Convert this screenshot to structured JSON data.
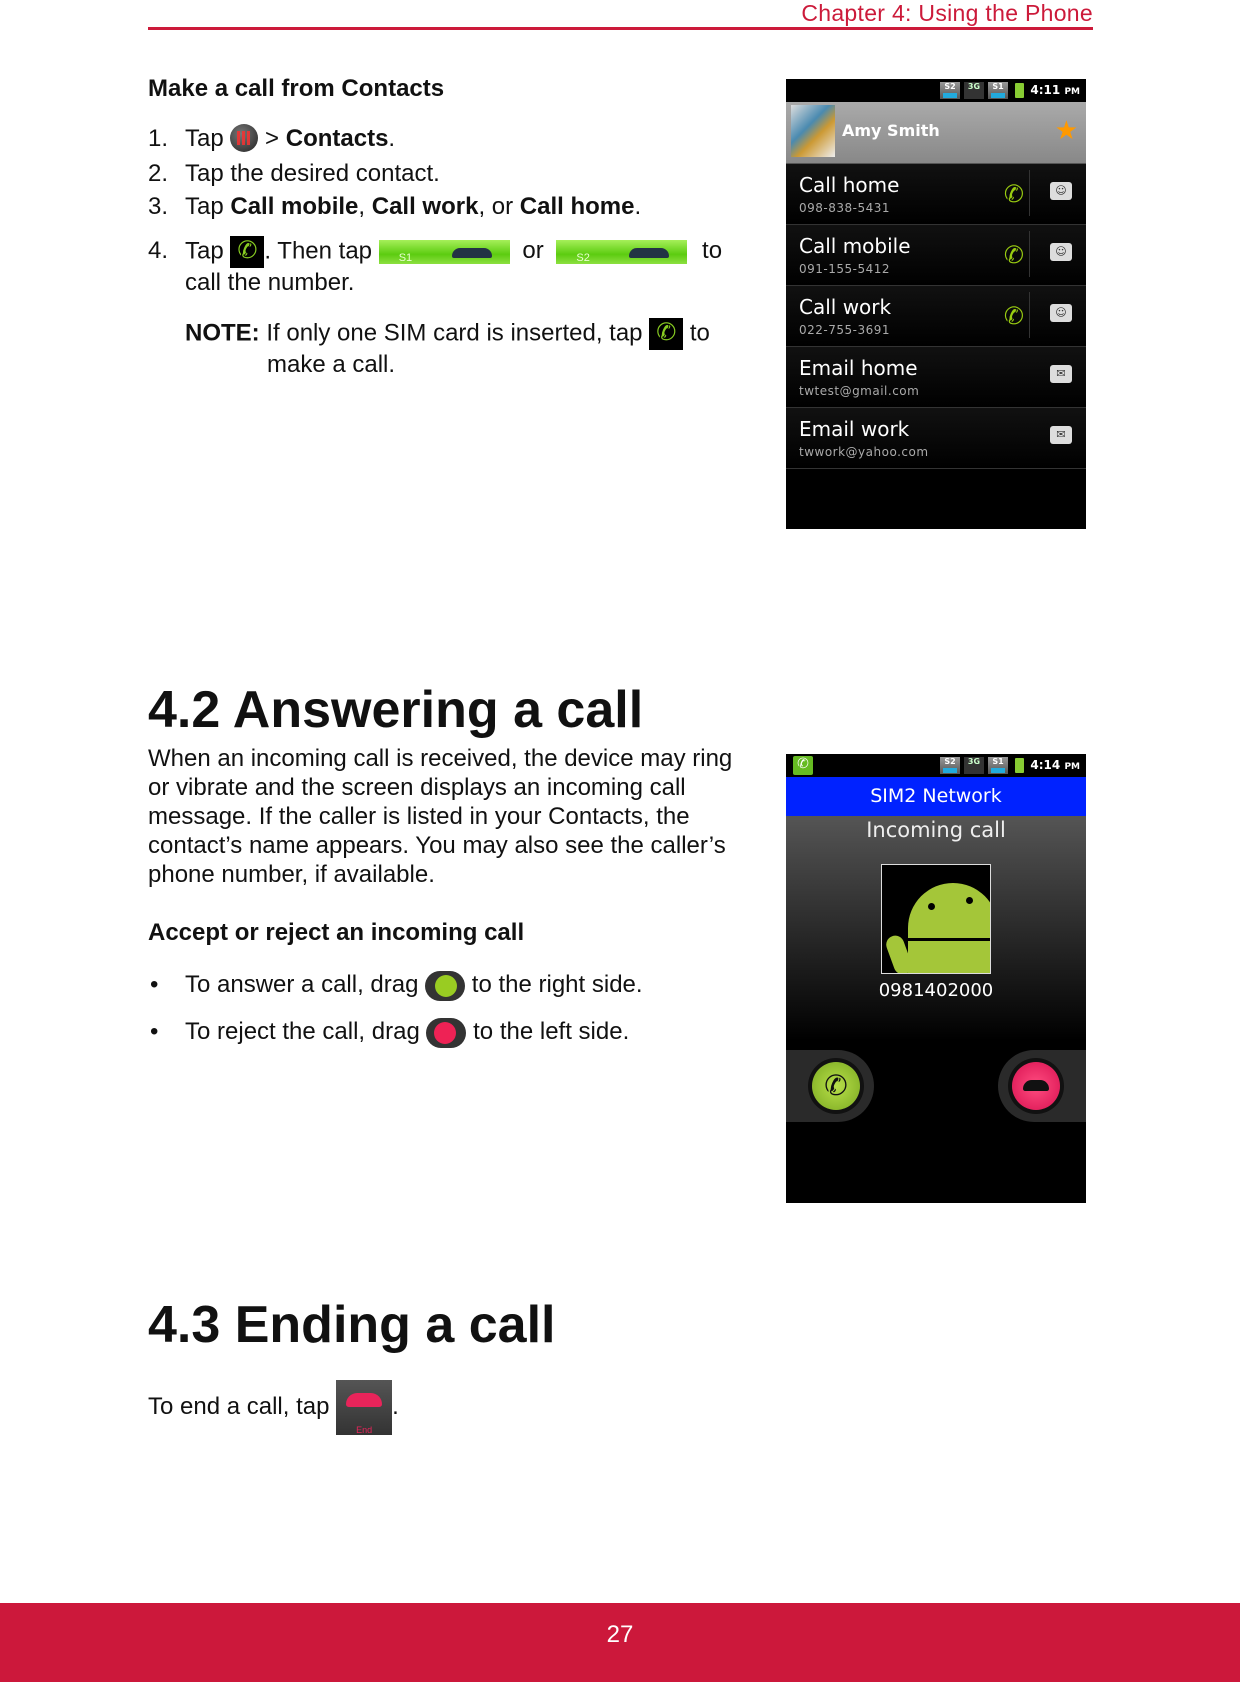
{
  "header": {
    "chapter": "Chapter 4: Using the Phone"
  },
  "section_contacts": {
    "title": "Make a call from Contacts",
    "steps": [
      {
        "num": "1.",
        "pre": "Tap",
        "mid": " > ",
        "bold": "Contacts",
        "post": "."
      },
      {
        "num": "2.",
        "text": "Tap the desired contact."
      },
      {
        "num": "3.",
        "pre": "Tap ",
        "b1": "Call mobile",
        "s1": ", ",
        "b2": "Call work",
        "s2": ", or ",
        "b3": "Call home",
        "post": "."
      },
      {
        "num": "4.",
        "pre": "Tap",
        "mid": ". Then tap",
        "or": "or",
        "to": "to",
        "line2": "call the number.",
        "sim1": "S1",
        "sim2": "S2"
      }
    ],
    "note_label": "NOTE:",
    "note_text": " If only one SIM card is inserted, tap",
    "note_to": "to",
    "note_line2": "make a call."
  },
  "phone1": {
    "time": "4:11",
    "ampm": "PM",
    "sig_s2": "S2",
    "sig_3g": "3G",
    "sig_s1": "S1",
    "contact_name": "Amy Smith",
    "rows": [
      {
        "label": "Call home",
        "detail": "098-838-5431",
        "type": "call"
      },
      {
        "label": "Call mobile",
        "detail": "091-155-5412",
        "type": "call"
      },
      {
        "label": "Call work",
        "detail": "022-755-3691",
        "type": "call"
      },
      {
        "label": "Email home",
        "detail": "twtest@gmail.com",
        "type": "email"
      },
      {
        "label": "Email work",
        "detail": "twwork@yahoo.com",
        "type": "email"
      }
    ]
  },
  "section_answer": {
    "title": "4.2 Answering a call",
    "para": [
      "When an incoming call is received, the device may ring",
      "or vibrate and the screen displays an incoming call",
      "message. If the caller is listed in your Contacts, the",
      "contact’s name appears. You may also see the caller’s",
      "phone number, if available."
    ],
    "subtitle": "Accept or reject an incoming call",
    "bullet1_pre": "To answer a call, drag",
    "bullet1_post": "to the right side.",
    "bullet2_pre": "To reject the call, drag",
    "bullet2_post": "to the left side.",
    "bullet": "•"
  },
  "phone2": {
    "time": "4:14",
    "ampm": "PM",
    "sig_s2": "S2",
    "sig_3g": "3G",
    "sig_s1": "S1",
    "network": "SIM2 Network",
    "status": "Incoming call",
    "number": "0981402000"
  },
  "section_end": {
    "title": "4.3 Ending a call",
    "text_pre": "To end a call, tap",
    "text_post": ".",
    "end_label": "End"
  },
  "footer": {
    "page": "27"
  },
  "colors": {
    "accent": "#cc183b",
    "sim_band": "#0022ff",
    "answer_green": "#9ccc2a",
    "reject_red": "#ee2060"
  }
}
